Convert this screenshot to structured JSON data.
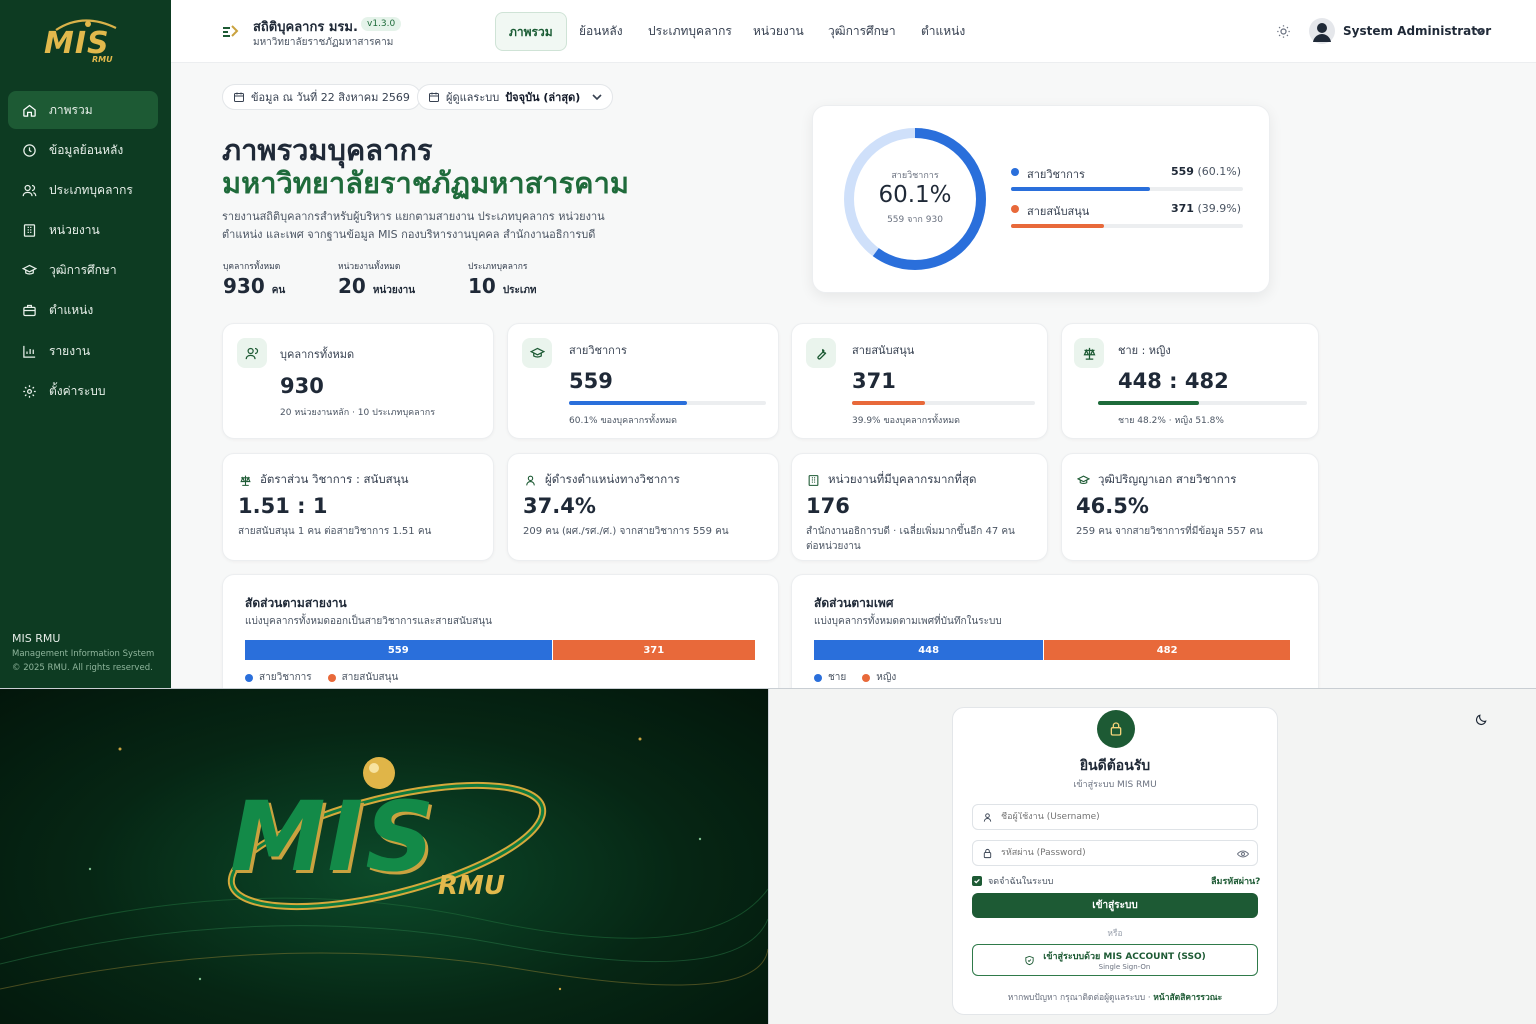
{
  "sidebar": {
    "brand": {
      "main": "MIS",
      "sub": "RMU"
    },
    "items": [
      {
        "label": "ภาพรวม",
        "icon": "home-icon"
      },
      {
        "label": "ข้อมูลย้อนหลัง",
        "icon": "history-icon"
      },
      {
        "label": "ประเภทบุคลากร",
        "icon": "users-icon"
      },
      {
        "label": "หน่วยงาน",
        "icon": "building-icon"
      },
      {
        "label": "วุฒิการศึกษา",
        "icon": "graduation-cap-icon"
      },
      {
        "label": "ตำแหน่ง",
        "icon": "briefcase-icon"
      },
      {
        "label": "รายงาน",
        "icon": "chart-icon"
      },
      {
        "label": "ตั้งค่าระบบ",
        "icon": "gear-icon"
      }
    ],
    "footer": {
      "title": "MIS RMU",
      "subtitle": "Management Information System",
      "copyright": "© 2025 RMU. All rights reserved."
    }
  },
  "topbar": {
    "title": "สถิติบุคลากร มรม.",
    "version": "v1.3.0",
    "subtitle": "มหาวิทยาลัยราชภัฏมหาสารคาม",
    "tabs": [
      "ภาพรวม",
      "ย้อนหลัง",
      "ประเภทบุคลากร",
      "หน่วยงาน",
      "วุฒิการศึกษา",
      "ตำแหน่ง"
    ],
    "user": "System Administrator"
  },
  "filters": {
    "date_label": "ข้อมูล ณ วันที่ 22 สิงหาคม 2569",
    "period_prefix": "ผู้ดูแลระบบ",
    "period_value": "ปัจจุบัน (ล่าสุด)"
  },
  "hero": {
    "title_line1": "ภาพรวมบุคลากร",
    "title_line2": "มหาวิทยาลัยราชภัฏมหาสารคาม",
    "description_line1": "รายงานสถิติบุคลากรสำหรับผู้บริหาร แยกตามสายงาน ประเภทบุคลากร หน่วยงาน",
    "description_line2": "ตำแหน่ง และเพศ จากฐานข้อมูล MIS กองบริหารงานบุคคล สำนักงานอธิการบดี",
    "stats": [
      {
        "label": "บุคลากรทั้งหมด",
        "value": "930",
        "unit": "คน"
      },
      {
        "label": "หน่วยงานทั้งหมด",
        "value": "20",
        "unit": "หน่วยงาน"
      },
      {
        "label": "ประเภทบุคลากร",
        "value": "10",
        "unit": "ประเภท"
      }
    ]
  },
  "donut": {
    "center_label": "สายวิชาการ",
    "center_value": "60.1%",
    "center_sub": "559 จาก 930",
    "fraction": 0.601,
    "rows": [
      {
        "label": "สายวิชาการ",
        "count": "559",
        "pct": "(60.1%)",
        "fraction": 0.601,
        "color": "#2a6fdb"
      },
      {
        "label": "สายสนับสนุน",
        "count": "371",
        "pct": "(39.9%)",
        "fraction": 0.399,
        "color": "#e8693a"
      }
    ]
  },
  "kpi1": [
    {
      "title": "บุคลากรทั้งหมด",
      "value": "930",
      "sub": "20 หน่วยงานหลัก · 10 ประเภทบุคลากร",
      "icon": "users-icon"
    },
    {
      "title": "สายวิชาการ",
      "value": "559",
      "sub": "60.1% ของบุคลากรทั้งหมด",
      "icon": "graduation-cap-icon",
      "fraction": 0.601,
      "color": "#2a6fdb"
    },
    {
      "title": "สายสนับสนุน",
      "value": "371",
      "sub": "39.9% ของบุคลากรทั้งหมด",
      "icon": "wrench-icon",
      "fraction": 0.399,
      "color": "#e8693a"
    },
    {
      "title": "ชาย : หญิง",
      "value": "448 : 482",
      "sub": "ชาย 48.2% · หญิง 51.8%",
      "icon": "scale-icon",
      "fraction": 0.482,
      "color": "#1d6b3a"
    }
  ],
  "kpi2": [
    {
      "title": "อัตราส่วน วิชาการ : สนับสนุน",
      "value": "1.51 : 1",
      "sub": "สายสนับสนุน 1 คน ต่อสายวิชาการ 1.51 คน",
      "icon": "scale-icon"
    },
    {
      "title": "ผู้ดำรงตำแหน่งทางวิชาการ",
      "value": "37.4%",
      "sub": "209 คน (ผศ./รศ./ศ.) จากสายวิชาการ 559 คน",
      "icon": "user-icon"
    },
    {
      "title": "หน่วยงานที่มีบุคลากรมากที่สุด",
      "value": "176",
      "sub": "สำนักงานอธิการบดี · เฉลี่ยเพิ่มมากขึ้นอีก 47 คน",
      "sub2": "ต่อหน่วยงาน",
      "icon": "building-icon"
    },
    {
      "title": "วุฒิปริญญาเอก สายวิชาการ",
      "value": "46.5%",
      "sub": "259 คน จากสายวิชาการที่มีข้อมูล 557 คน",
      "icon": "graduation-cap-icon"
    }
  ],
  "sections": [
    {
      "title": "สัดส่วนตามสายงาน",
      "subtitle": "แบ่งบุคลากรทั้งหมดออกเป็นสายวิชาการและสายสนับสนุน",
      "segments": [
        {
          "name": "สายวิชาการ",
          "value": 559,
          "label": "559",
          "color": "#2a6fdb"
        },
        {
          "name": "สายสนับสนุน",
          "value": 371,
          "label": "371",
          "color": "#e8693a"
        }
      ]
    },
    {
      "title": "สัดส่วนตามเพศ",
      "subtitle": "แบ่งบุคลากรทั้งหมดตามเพศที่บันทึกในระบบ",
      "segments": [
        {
          "name": "ชาย",
          "value": 448,
          "label": "448",
          "color": "#2a6fdb"
        },
        {
          "name": "หญิง",
          "value": 482,
          "label": "482",
          "color": "#e8693a"
        }
      ]
    }
  ],
  "splash": {
    "brand_main": "MIS",
    "brand_sub": "RMU"
  },
  "login": {
    "title": "ยินดีต้อนรับ",
    "subtitle": "เข้าสู่ระบบ MIS RMU",
    "username_placeholder": "ชื่อผู้ใช้งาน (Username)",
    "password_placeholder": "รหัสผ่าน (Password)",
    "remember": "จดจำฉันในระบบ",
    "forgot": "ลืมรหัสผ่าน?",
    "submit": "เข้าสู่ระบบ",
    "or": "หรือ",
    "sso_label": "เข้าสู่ระบบด้วย MIS ACCOUNT (SSO)",
    "sso_sub": "Single Sign-On",
    "help_prefix": "หากพบปัญหา กรุณาติดต่อผู้ดูแลระบบ ·",
    "help_link": "หน้าสัตสิคารรวณะ"
  }
}
